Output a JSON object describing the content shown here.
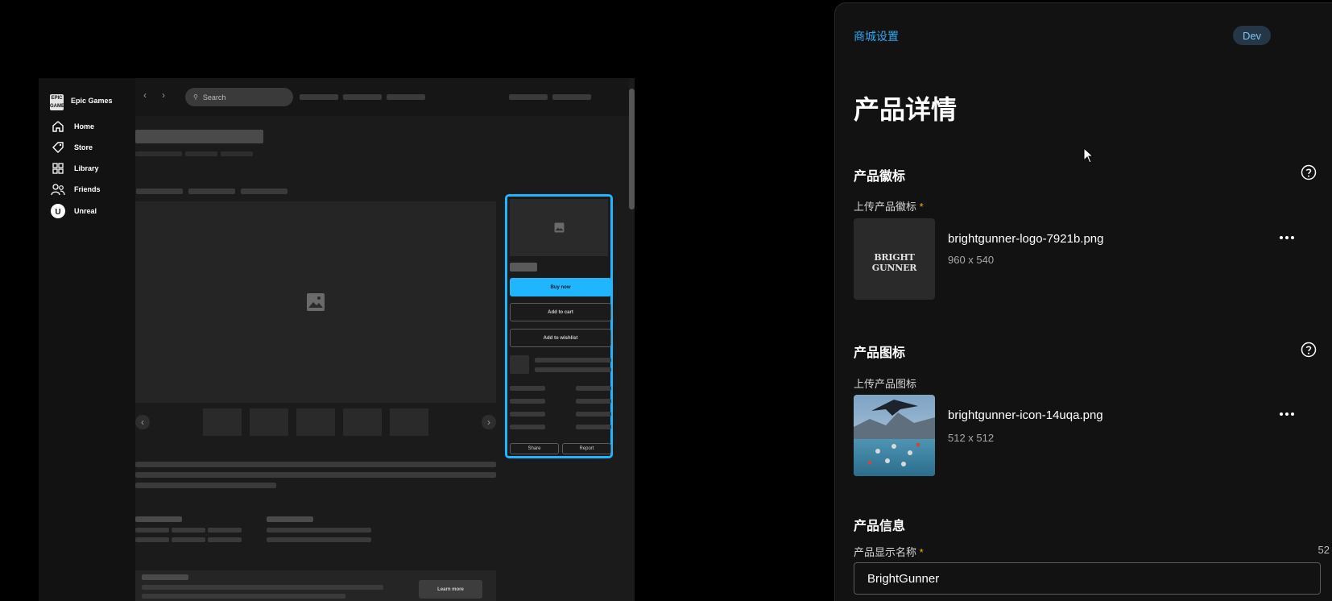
{
  "preview": {
    "brand": "Epic Games",
    "nav": [
      {
        "label": "Home",
        "icon": "home-icon"
      },
      {
        "label": "Store",
        "icon": "tag-icon"
      },
      {
        "label": "Library",
        "icon": "grid-icon"
      },
      {
        "label": "Friends",
        "icon": "friends-icon"
      },
      {
        "label": "Unreal",
        "icon": "unreal-icon"
      }
    ],
    "search_placeholder": "Search",
    "buy_now": "Buy now",
    "add_to_cart": "Add to cart",
    "add_to_wishlist": "Add to wishlist",
    "share": "Share",
    "report": "Report",
    "learn_more": "Learn more",
    "accent": "#1fb6ff"
  },
  "settings": {
    "breadcrumb": "商城设置",
    "env_badge": "Dev",
    "title": "产品详情",
    "logo_section": {
      "title": "产品徽标",
      "upload_label": "上传产品徽标",
      "required_mark": "*",
      "logo_text": "BRIGHT GUNNER",
      "file_name": "brightgunner-logo-7921b.png",
      "file_dims": "960 x 540"
    },
    "icon_section": {
      "title": "产品图标",
      "upload_label": "上传产品图标",
      "file_name": "brightgunner-icon-14uqa.png",
      "file_dims": "512 x 512"
    },
    "info_section": {
      "title": "产品信息",
      "name_label": "产品显示名称",
      "required_mark": "*",
      "char_count": "52",
      "name_value": "BrightGunner"
    },
    "link_color": "#2ea8f0",
    "required_color": "#f4b400"
  }
}
